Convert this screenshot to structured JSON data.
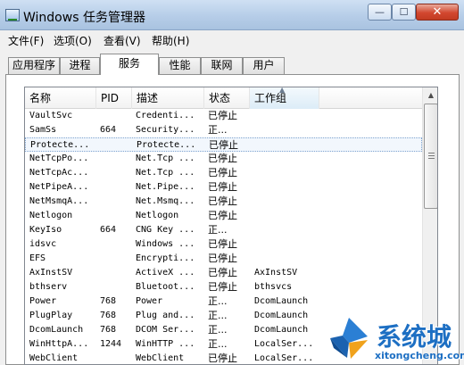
{
  "window": {
    "title": "Windows 任务管理器",
    "minimize_glyph": "—",
    "maximize_glyph": "☐",
    "close_glyph": "✕"
  },
  "menu": [
    "文件(F)",
    "选项(O)",
    "查看(V)",
    "帮助(H)"
  ],
  "tabs": [
    {
      "label": "应用程序",
      "active": false
    },
    {
      "label": "进程",
      "active": false
    },
    {
      "label": "服务",
      "active": true
    },
    {
      "label": "性能",
      "active": false
    },
    {
      "label": "联网",
      "active": false
    },
    {
      "label": "用户",
      "active": false
    }
  ],
  "columns": [
    "名称",
    "PID",
    "描述",
    "状态",
    "工作组"
  ],
  "sorted_column": "工作组",
  "rows": [
    {
      "name": "VaultSvc",
      "pid": "",
      "desc": "Credenti...",
      "status": "已停止",
      "group": "",
      "selected": false
    },
    {
      "name": "SamSs",
      "pid": "664",
      "desc": "Security...",
      "status": "正...",
      "group": "",
      "selected": false
    },
    {
      "name": "Protecte...",
      "pid": "",
      "desc": "Protecte...",
      "status": "已停止",
      "group": "",
      "selected": true
    },
    {
      "name": "NetTcpPo...",
      "pid": "",
      "desc": "Net.Tcp ...",
      "status": "已停止",
      "group": "",
      "selected": false
    },
    {
      "name": "NetTcpAc...",
      "pid": "",
      "desc": "Net.Tcp ...",
      "status": "已停止",
      "group": "",
      "selected": false
    },
    {
      "name": "NetPipeA...",
      "pid": "",
      "desc": "Net.Pipe...",
      "status": "已停止",
      "group": "",
      "selected": false
    },
    {
      "name": "NetMsmqA...",
      "pid": "",
      "desc": "Net.Msmq...",
      "status": "已停止",
      "group": "",
      "selected": false
    },
    {
      "name": "Netlogon",
      "pid": "",
      "desc": "Netlogon",
      "status": "已停止",
      "group": "",
      "selected": false
    },
    {
      "name": "KeyIso",
      "pid": "664",
      "desc": "CNG Key ...",
      "status": "正...",
      "group": "",
      "selected": false
    },
    {
      "name": "idsvc",
      "pid": "",
      "desc": "Windows ...",
      "status": "已停止",
      "group": "",
      "selected": false
    },
    {
      "name": "EFS",
      "pid": "",
      "desc": "Encrypti...",
      "status": "已停止",
      "group": "",
      "selected": false
    },
    {
      "name": "AxInstSV",
      "pid": "",
      "desc": "ActiveX ...",
      "status": "已停止",
      "group": "AxInstSV",
      "selected": false
    },
    {
      "name": "bthserv",
      "pid": "",
      "desc": "Bluetoot...",
      "status": "已停止",
      "group": "bthsvcs",
      "selected": false
    },
    {
      "name": "Power",
      "pid": "768",
      "desc": "Power",
      "status": "正...",
      "group": "DcomLaunch",
      "selected": false
    },
    {
      "name": "PlugPlay",
      "pid": "768",
      "desc": "Plug and...",
      "status": "正...",
      "group": "DcomLaunch",
      "selected": false
    },
    {
      "name": "DcomLaunch",
      "pid": "768",
      "desc": "DCOM Ser...",
      "status": "正...",
      "group": "DcomLaunch",
      "selected": false
    },
    {
      "name": "WinHttpA...",
      "pid": "1244",
      "desc": "WinHTTP ...",
      "status": "正...",
      "group": "LocalSer...",
      "selected": false
    },
    {
      "name": "WebClient",
      "pid": "",
      "desc": "WebClient",
      "status": "已停止",
      "group": "LocalSer...",
      "selected": false
    }
  ],
  "scrollbar": {
    "up_glyph": "▲",
    "sort_glyph": "▲"
  },
  "watermark": {
    "brand": "系统城",
    "url": "xitongcheng.com"
  }
}
